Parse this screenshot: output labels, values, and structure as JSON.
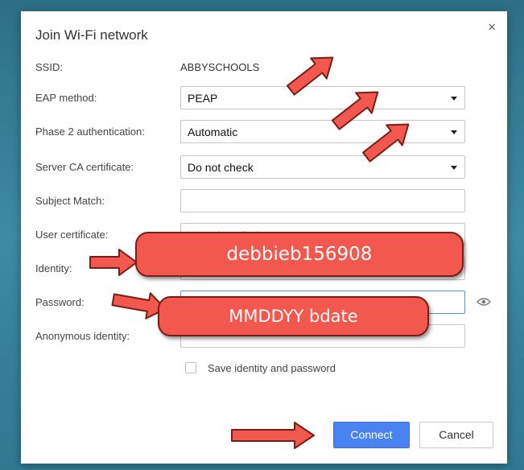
{
  "dialog": {
    "title": "Join Wi-Fi network",
    "close_symbol": "×"
  },
  "form": {
    "ssid_label": "SSID:",
    "ssid_value": "ABBYSCHOOLS",
    "eap_label": "EAP method:",
    "eap_value": "PEAP",
    "phase2_label": "Phase 2 authentication:",
    "phase2_value": "Automatic",
    "server_ca_label": "Server CA certificate:",
    "server_ca_value": "Do not check",
    "subject_match_label": "Subject Match:",
    "subject_match_value": "",
    "user_cert_label": "User certificate:",
    "user_cert_value": "None installed",
    "identity_label": "Identity:",
    "password_label": "Password:",
    "anon_identity_label": "Anonymous identity:",
    "save_identity_label": "Save identity and password",
    "save_identity_checked": false
  },
  "buttons": {
    "connect": "Connect",
    "cancel": "Cancel"
  },
  "annotations": {
    "identity_callout": "debbieb156908",
    "password_callout": "MMDDYY bdate"
  },
  "icons": {
    "close": "close-icon",
    "show_password": "eye-icon",
    "dropdown": "chevron-down-icon",
    "annotation_arrow": "arrow-icon"
  },
  "colors": {
    "connect_button": "#4a82f2",
    "annotation_fill": "#f2584e",
    "annotation_border": "#7a1d17",
    "background": "#3c8aa3"
  }
}
